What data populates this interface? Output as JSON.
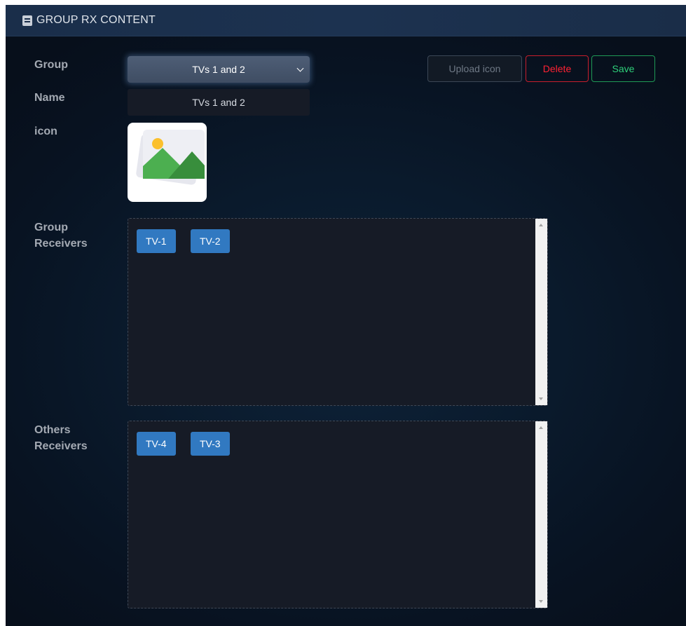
{
  "header": {
    "icon": "book-icon",
    "title": "GROUP RX CONTENT"
  },
  "form": {
    "group_label": "Group",
    "group_selected": "TVs 1 and 2",
    "name_label": "Name",
    "name_value": "TVs 1 and 2",
    "icon_label": "icon",
    "icon_image": "image-placeholder-icon"
  },
  "actions": {
    "upload_label": "Upload icon",
    "delete_label": "Delete",
    "save_label": "Save"
  },
  "group_receivers": {
    "label_line1": "Group",
    "label_line2": "Receivers",
    "items": [
      "TV-1",
      "TV-2"
    ]
  },
  "others_receivers": {
    "label_line1": "Others",
    "label_line2": "Receivers",
    "items": [
      "TV-4",
      "TV-3"
    ]
  },
  "colors": {
    "chip": "#3179c1",
    "delete": "#ff2233",
    "save": "#2ed07a"
  }
}
